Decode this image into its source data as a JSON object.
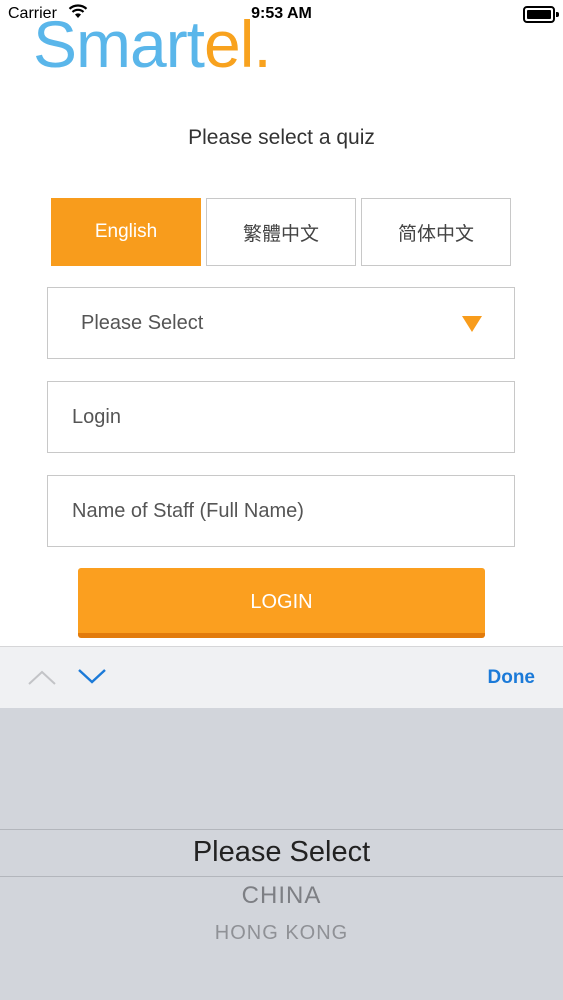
{
  "status_bar": {
    "carrier": "Carrier",
    "time": "9:53 AM"
  },
  "logo": {
    "part1": "Smart",
    "part2": "el.",
    "color_primary": "#5ab6ea",
    "color_accent": "#f8a21e"
  },
  "prompt": "Please select a quiz",
  "languages": [
    {
      "label": "English",
      "selected": true
    },
    {
      "label": "繁體中文",
      "selected": false
    },
    {
      "label": "简体中文",
      "selected": false
    }
  ],
  "form": {
    "quiz_select_value": "Please Select",
    "login_placeholder": "Login",
    "staff_placeholder": "Name of Staff (Full Name)",
    "login_button": "LOGIN"
  },
  "keyboard_toolbar": {
    "prev_icon": "chevron-up-icon",
    "next_icon": "chevron-down-icon",
    "done_label": "Done"
  },
  "picker": {
    "options": [
      "Please Select",
      "CHINA",
      "HONG KONG"
    ],
    "selected_index": 0
  },
  "colors": {
    "accent": "#f89c1c",
    "link": "#1b7ad8"
  }
}
